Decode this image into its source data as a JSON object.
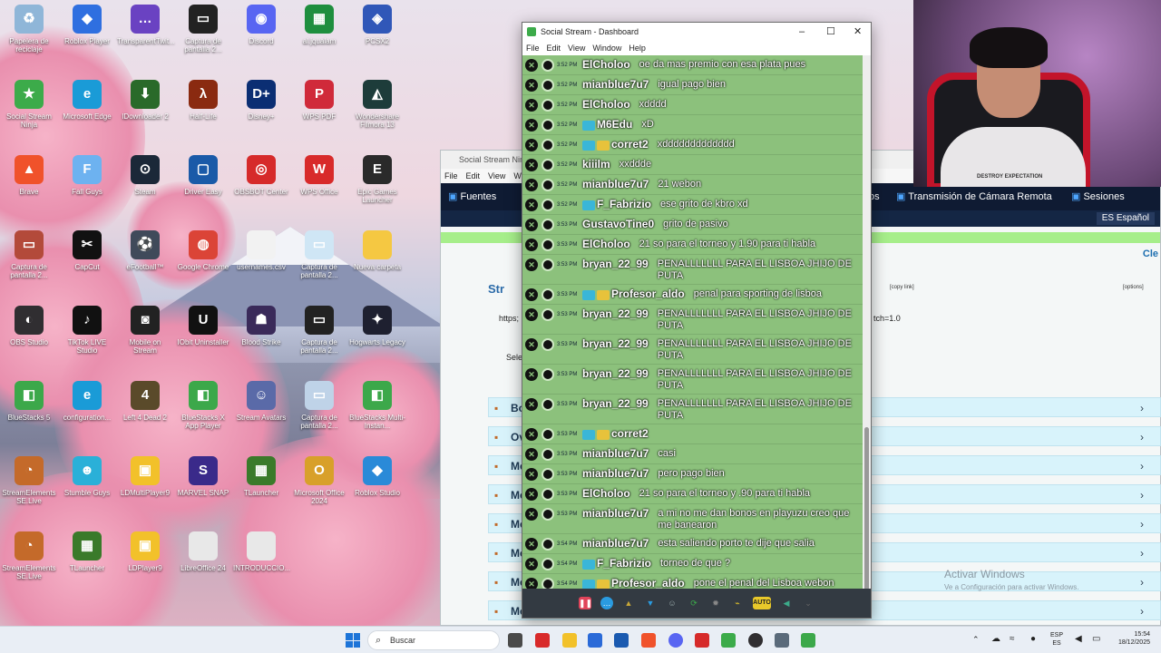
{
  "desktop": {
    "icons": [
      {
        "label": "Papelera de reciclaje",
        "icon": "recycle-bin-icon",
        "color": "#8fb6d8",
        "glyph": "♻"
      },
      {
        "label": "Roblox Player",
        "icon": "roblox-icon",
        "color": "#2f6fe0",
        "glyph": "◆"
      },
      {
        "label": "TransparentTwit...",
        "icon": "twitch-icon",
        "color": "#6a42c2",
        "glyph": "…"
      },
      {
        "label": "Captura de pantalla 2...",
        "icon": "screenshot-icon",
        "color": "#222222",
        "glyph": "▭"
      },
      {
        "label": "Discord",
        "icon": "discord-icon",
        "color": "#5865f2",
        "glyph": "◉"
      },
      {
        "label": "al.jqualam",
        "icon": "spreadsheet-icon",
        "color": "#1e8e3e",
        "glyph": "▦"
      },
      {
        "label": "PCSX2",
        "icon": "pcsx2-icon",
        "color": "#3057b8",
        "glyph": "◈"
      },
      {
        "label": "Social Stream Ninja",
        "icon": "social-stream-icon",
        "color": "#3cab4a",
        "glyph": "★"
      },
      {
        "label": "Microsoft Edge",
        "icon": "edge-icon",
        "color": "#1a9bd7",
        "glyph": "e"
      },
      {
        "label": "IDownloader 2",
        "icon": "downloader-icon",
        "color": "#2a6a2a",
        "glyph": "⬇"
      },
      {
        "label": "Half-Life",
        "icon": "half-life-icon",
        "color": "#8a2a10",
        "glyph": "λ"
      },
      {
        "label": "Disney+",
        "icon": "disney-icon",
        "color": "#0b2e73",
        "glyph": "D+"
      },
      {
        "label": "WPS PDF",
        "icon": "wps-pdf-icon",
        "color": "#d02a3a",
        "glyph": "P"
      },
      {
        "label": "Wondershare Filmora 13",
        "icon": "filmora-icon",
        "color": "#1d3c3a",
        "glyph": "◭"
      },
      {
        "label": "Brave",
        "icon": "brave-icon",
        "color": "#f0522b",
        "glyph": "▲"
      },
      {
        "label": "Fall Guys",
        "icon": "fall-guys-icon",
        "color": "#6db2f0",
        "glyph": "F"
      },
      {
        "label": "Steam",
        "icon": "steam-icon",
        "color": "#1b2838",
        "glyph": "⊙"
      },
      {
        "label": "Driver Easy",
        "icon": "driver-easy-icon",
        "color": "#1a5aa8",
        "glyph": "▢"
      },
      {
        "label": "OBSBOT Center",
        "icon": "obsbot-icon",
        "color": "#d62a2a",
        "glyph": "◎"
      },
      {
        "label": "WPS Office",
        "icon": "wps-office-icon",
        "color": "#d82a2a",
        "glyph": "W"
      },
      {
        "label": "Epic Games Launcher",
        "icon": "epic-games-icon",
        "color": "#2a2a2a",
        "glyph": "E"
      },
      {
        "label": "Captura de pantalla 2...",
        "icon": "screenshot-icon",
        "color": "#b34a3a",
        "glyph": "▭"
      },
      {
        "label": "CapCut",
        "icon": "capcut-icon",
        "color": "#111111",
        "glyph": "✂"
      },
      {
        "label": "eFootball™",
        "icon": "efootball-icon",
        "color": "#404a5a",
        "glyph": "⚽"
      },
      {
        "label": "Google Chrome",
        "icon": "chrome-icon",
        "color": "#db4437",
        "glyph": "◍"
      },
      {
        "label": "usernames.csv",
        "icon": "file-icon",
        "color": "#f2f2f2",
        "glyph": ""
      },
      {
        "label": "Captura de pantalla 2...",
        "icon": "screenshot-icon",
        "color": "#cfe6f5",
        "glyph": "▭"
      },
      {
        "label": "Nueva carpeta",
        "icon": "folder-icon",
        "color": "#f5c842",
        "glyph": ""
      },
      {
        "label": "OBS Studio",
        "icon": "obs-icon",
        "color": "#302e31",
        "glyph": "◐"
      },
      {
        "label": "TikTok LIVE Studio",
        "icon": "tiktok-icon",
        "color": "#111111",
        "glyph": "♪"
      },
      {
        "label": "Mobile on Stream",
        "icon": "mobile-stream-icon",
        "color": "#222222",
        "glyph": "◙"
      },
      {
        "label": "IObit Uninstaller",
        "icon": "iobit-icon",
        "color": "#111111",
        "glyph": "U"
      },
      {
        "label": "Blood Strike",
        "icon": "blood-strike-icon",
        "color": "#3a2a5a",
        "glyph": "☗"
      },
      {
        "label": "Captura de pantalla 2...",
        "icon": "screenshot-icon",
        "color": "#222222",
        "glyph": "▭"
      },
      {
        "label": "Hogwarts Legacy",
        "icon": "hogwarts-icon",
        "color": "#1e2030",
        "glyph": "✦"
      },
      {
        "label": "BlueStacks 5",
        "icon": "bluestacks-icon",
        "color": "#3ca84a",
        "glyph": "◧"
      },
      {
        "label": "configuration...",
        "icon": "edge-icon",
        "color": "#1a9bd7",
        "glyph": "e"
      },
      {
        "label": "Left 4 Dead 2",
        "icon": "left4dead-icon",
        "color": "#5a4a2a",
        "glyph": "4"
      },
      {
        "label": "BlueStacks X App Player",
        "icon": "bluestacks-x-icon",
        "color": "#3ca84a",
        "glyph": "◧"
      },
      {
        "label": "Stream Avatars",
        "icon": "stream-avatars-icon",
        "color": "#5a6aa8",
        "glyph": "☺"
      },
      {
        "label": "Captura de pantalla 2...",
        "icon": "screenshot-icon",
        "color": "#bfd3e8",
        "glyph": "▭"
      },
      {
        "label": "BlueStacks Multi-Instan...",
        "icon": "bluestacks-multi-icon",
        "color": "#3ca84a",
        "glyph": "◧"
      },
      {
        "label": "StreamElements SE.Live",
        "icon": "streamelements-icon",
        "color": "#c46a2a",
        "glyph": "◔"
      },
      {
        "label": "Stumble Guys",
        "icon": "stumble-guys-icon",
        "color": "#2ab0d8",
        "glyph": "☻"
      },
      {
        "label": "LDMultiPlayer9",
        "icon": "ldplayer-icon",
        "color": "#f2c12a",
        "glyph": "▣"
      },
      {
        "label": "MARVEL SNAP",
        "icon": "marvel-snap-icon",
        "color": "#3a2a8a",
        "glyph": "S"
      },
      {
        "label": "TLauncher",
        "icon": "tlauncher-icon",
        "color": "#3a7a2a",
        "glyph": "▦"
      },
      {
        "label": "Microsoft Office 2024",
        "icon": "office-icon",
        "color": "#d8a02a",
        "glyph": "O"
      },
      {
        "label": "Roblox Studio",
        "icon": "roblox-studio-icon",
        "color": "#2a8ad8",
        "glyph": "◆"
      },
      {
        "label": "StreamElements SE.Live",
        "icon": "streamelements-icon",
        "color": "#c46a2a",
        "glyph": "◔"
      },
      {
        "label": "TLauncher",
        "icon": "tlauncher-icon",
        "color": "#3a7a2a",
        "glyph": "▦"
      },
      {
        "label": "LDPlayer9",
        "icon": "ldplayer-icon",
        "color": "#f2c12a",
        "glyph": "▣"
      },
      {
        "label": "LibreOffice 24",
        "icon": "libreoffice-icon",
        "color": "#e8e8e8",
        "glyph": ""
      },
      {
        "label": "INTRODUCCIO...",
        "icon": "doc-icon",
        "color": "#e8e8e8",
        "glyph": ""
      }
    ]
  },
  "webcam": {
    "shirt_text": "DESTROY EXPECTATION"
  },
  "background_browser": {
    "title": "Social Stream Ninja",
    "menu": [
      "File",
      "Edit",
      "View",
      "Wind"
    ],
    "nav_left": "Fuentes",
    "nav_partial": "os",
    "nav_remote": "Transmisión de Cámara Remota",
    "nav_sessions": "Sesiones",
    "language": "ES Español",
    "clear_partial": "Cle",
    "stream_partial": "Str",
    "url_partial": "https;",
    "copy_link": "[copy link]",
    "options": "[options]",
    "url_param": "tch=1.0",
    "select_partial": "Sele",
    "accordion": [
      {
        "label": "Bo",
        "icon": "box-icon"
      },
      {
        "label": "Ov",
        "icon": "overlay-icon"
      },
      {
        "label": "Me",
        "icon": "message-icon"
      },
      {
        "label": "Me",
        "icon": "message-icon"
      },
      {
        "label": "Me",
        "icon": "message-icon"
      },
      {
        "label": "Me",
        "icon": "message-icon"
      },
      {
        "label": "Me",
        "icon": "message-icon"
      },
      {
        "label": "Me",
        "icon": "message-icon"
      },
      {
        "label": "Me",
        "icon": "message-icon"
      }
    ]
  },
  "social_stream": {
    "title": "Social Stream - Dashboard",
    "menu": [
      "File",
      "Edit",
      "View",
      "Window",
      "Help"
    ],
    "messages": [
      {
        "time": "3:52 PM",
        "name": "ElCholoo",
        "text": "oe da mas premio con esa plata pues",
        "badges": 0
      },
      {
        "time": "3:52 PM",
        "name": "mianblue7u7",
        "text": "igual pago bien",
        "badges": 0
      },
      {
        "time": "3:52 PM",
        "name": "ElCholoo",
        "text": "xdddd",
        "badges": 0
      },
      {
        "time": "3:52 PM",
        "name": "M6Edu",
        "text": "xD",
        "badges": 1
      },
      {
        "time": "3:52 PM",
        "name": "corret2",
        "text": "xddddddddddddd",
        "badges": 2
      },
      {
        "time": "3:52 PM",
        "name": "kiiilm",
        "text": "xxddde",
        "badges": 0
      },
      {
        "time": "3:52 PM",
        "name": "mianblue7u7",
        "text": "21 webon",
        "badges": 0
      },
      {
        "time": "3:52 PM",
        "name": "F_Fabrizio",
        "text": "ese grito de kbro xd",
        "badges": 1
      },
      {
        "time": "3:53 PM",
        "name": "GustavoTine0",
        "text": "grito de pasivo",
        "badges": 0
      },
      {
        "time": "3:53 PM",
        "name": "ElCholoo",
        "text": "21 so para el torneo y 1.90 para ti habla",
        "badges": 0
      },
      {
        "time": "3:53 PM",
        "name": "bryan_22_99",
        "text": "PENALLLLLLL PARA EL LISBOA JHIJO DE PUTA",
        "badges": 0
      },
      {
        "time": "3:53 PM",
        "name": "Profesor_aldo",
        "text": "penal para sporting de lisboa",
        "badges": 2
      },
      {
        "time": "3:53 PM",
        "name": "bryan_22_99",
        "text": "PENALLLLLLL PARA EL LISBOA JHIJO DE PUTA",
        "badges": 0
      },
      {
        "time": "3:53 PM",
        "name": "bryan_22_99",
        "text": "PENALLLLLLL PARA EL LISBOA JHIJO DE PUTA",
        "badges": 0
      },
      {
        "time": "3:53 PM",
        "name": "bryan_22_99",
        "text": "PENALLLLLLL PARA EL LISBOA JHIJO DE PUTA",
        "badges": 0
      },
      {
        "time": "3:53 PM",
        "name": "bryan_22_99",
        "text": "PENALLLLLLL PARA EL LISBOA JHIJO DE PUTA",
        "badges": 0
      },
      {
        "time": "3:53 PM",
        "name": "corret2",
        "text": "",
        "badges": 2
      },
      {
        "time": "3:53 PM",
        "name": "mianblue7u7",
        "text": "casi",
        "badges": 0
      },
      {
        "time": "3:53 PM",
        "name": "mianblue7u7",
        "text": "pero pago bien",
        "badges": 0
      },
      {
        "time": "3:53 PM",
        "name": "ElCholoo",
        "text": "21 so para el torneo y .90 para ti habla",
        "badges": 0
      },
      {
        "time": "3:53 PM",
        "name": "mianblue7u7",
        "text": "a mi no me dan bonos en playuzu creo que me banearon",
        "badges": 0
      },
      {
        "time": "3:54 PM",
        "name": "mianblue7u7",
        "text": "esta saliendo porto te dije que salia",
        "badges": 0
      },
      {
        "time": "3:54 PM",
        "name": "F_Fabrizio",
        "text": "torneo de que ?",
        "badges": 1
      },
      {
        "time": "3:54 PM",
        "name": "Profesor_aldo",
        "text": "pone el penal del Lisboa webon",
        "badges": 2
      }
    ],
    "toolbar_auto": "AUTO"
  },
  "watermark": {
    "line1": "Activar Windows",
    "line2": "Ve a Configuración para activar Windows."
  },
  "taskbar": {
    "search_placeholder": "Buscar",
    "lang_top": "ESP",
    "lang_bottom": "ES",
    "time": "15:54",
    "date": "18/12/2025"
  }
}
